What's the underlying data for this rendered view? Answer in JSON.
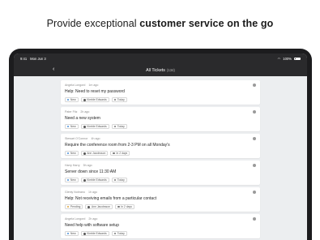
{
  "promo": {
    "text_prefix": "Provide exceptional ",
    "text_bold": "customer service on the go"
  },
  "status_bar": {
    "time": "9:41",
    "date": "Mon Jun 3",
    "battery": "100%"
  },
  "nav": {
    "title": "All Tickets",
    "count": "(134)"
  },
  "tickets": [
    {
      "requester": "Angela Longord",
      "time": "1m ago",
      "subject": "Help: Need to reset my password",
      "status": "New",
      "status_color": "#4a90d9",
      "assignee": "Kimble Edwards",
      "due": "Today"
    },
    {
      "requester": "Pater Fitz",
      "time": "2h ago",
      "subject": "Need a new system",
      "status": "New",
      "status_color": "#4a90d9",
      "assignee": "Kimble Edwards",
      "due": "Today"
    },
    {
      "requester": "Stewart O'Connor",
      "time": "4h ago",
      "subject": "Require the conference room from 2-3 PM on all Monday's",
      "status": "New",
      "status_color": "#4a90d9",
      "assignee": "Ann Jacobsson",
      "due": "In 2 days"
    },
    {
      "requester": "Harry Harry",
      "time": "5h ago",
      "subject": "Server down since 11:30 AM",
      "status": "New",
      "status_color": "#4a90d9",
      "assignee": "Kimble Edwards",
      "due": "Today"
    },
    {
      "requester": "Glenly Nobrano",
      "time": "1h ago",
      "subject": "Help: Not receiving emails from a particular contact",
      "status": "Pending",
      "status_color": "#e0a43a",
      "assignee": "Ann Jacobsson",
      "due": "In 2 days"
    },
    {
      "requester": "Angela Longord",
      "time": "2h ago",
      "subject": "Need help with software setup",
      "status": "New",
      "status_color": "#4a90d9",
      "assignee": "Kimble Edwards",
      "due": "Today"
    }
  ]
}
